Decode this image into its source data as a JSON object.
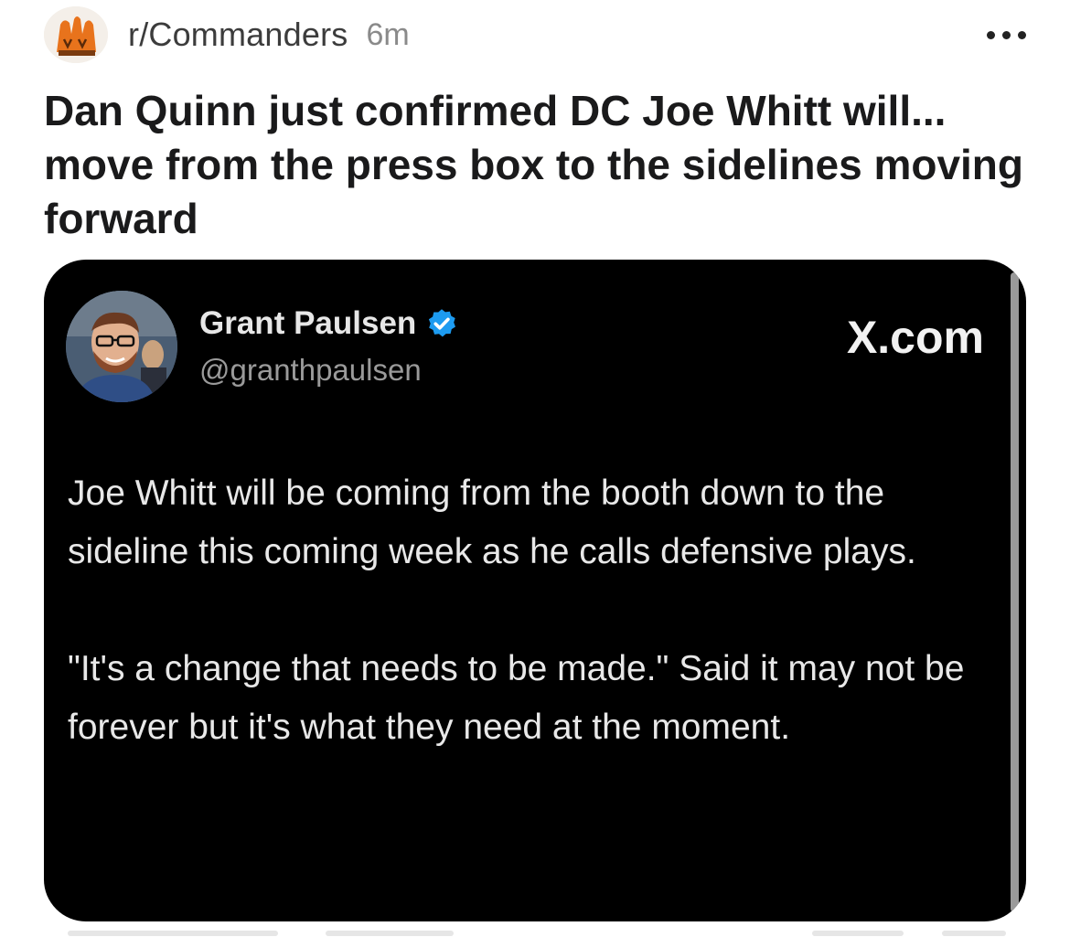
{
  "post": {
    "subreddit": "r/Commanders",
    "time": "6m",
    "title": "Dan Quinn just confirmed DC Joe Whitt will... move from the press box to the sidelines moving forward",
    "avatar_icon": "commanders-subreddit-avatar-icon",
    "more_icon": "more-options-icon"
  },
  "tweet": {
    "author_name": "Grant Paulsen",
    "handle": "@granthpaulsen",
    "source": "X.com",
    "verified_icon": "verified-badge-icon",
    "paragraphs": [
      "Joe Whitt will be coming from the booth down to the sideline this coming week as he calls defensive plays.",
      "\"It's a change that needs to be made.\" Said it may not be forever but it's what they need at the moment."
    ]
  },
  "colors": {
    "card_bg": "#000000",
    "verified_blue": "#1d9bf0",
    "avatar_orange": "#e8731c"
  }
}
